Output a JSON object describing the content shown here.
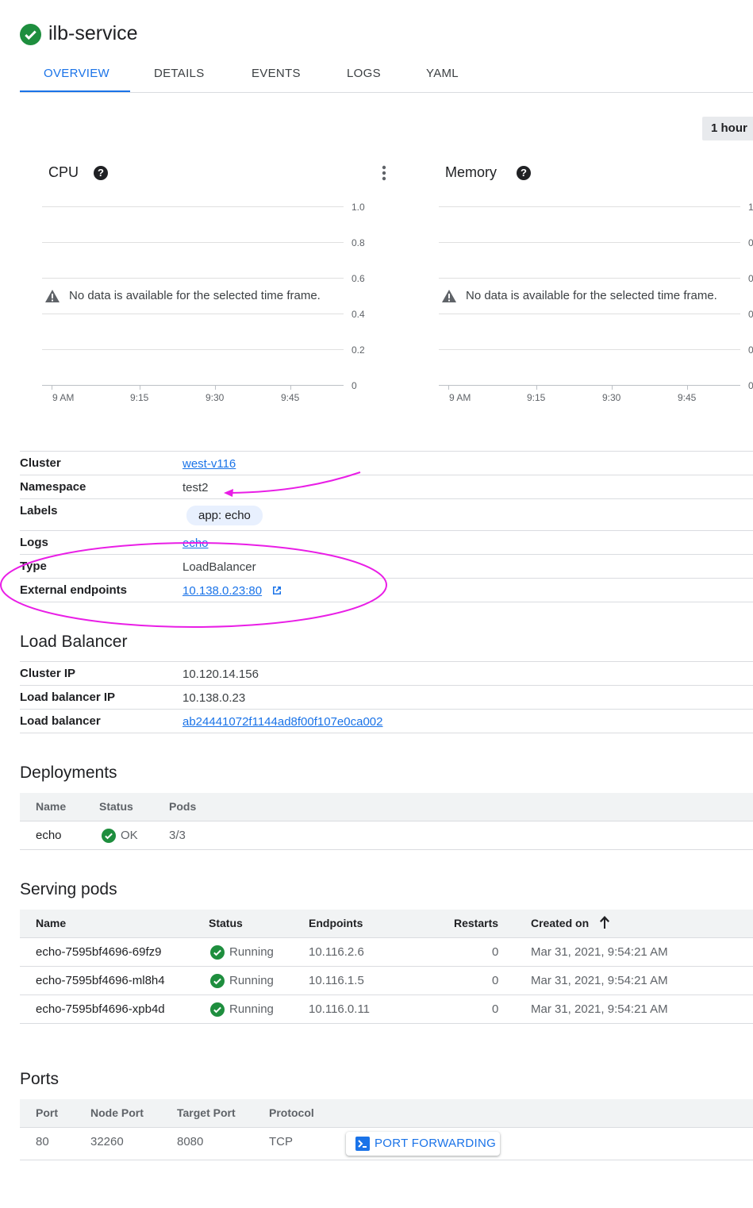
{
  "header": {
    "title": "ilb-service",
    "status_icon": "check-circle-icon",
    "status_color": "#1e8e3e"
  },
  "tabs": [
    {
      "label": "OVERVIEW",
      "active": true
    },
    {
      "label": "DETAILS"
    },
    {
      "label": "EVENTS"
    },
    {
      "label": "LOGS"
    },
    {
      "label": "YAML"
    }
  ],
  "time_range": "1 hour",
  "charts": {
    "cpu": {
      "title": "CPU",
      "no_data": "No data is available for the selected time frame.",
      "y_ticks": [
        "1.0",
        "0.8",
        "0.6",
        "0.4",
        "0.2",
        "0"
      ],
      "x_ticks": [
        "9 AM",
        "9:15",
        "9:30",
        "9:45"
      ]
    },
    "memory": {
      "title": "Memory",
      "no_data": "No data is available for the selected time frame.",
      "y_ticks": [
        "1",
        "0",
        "0",
        "0",
        "0",
        "0"
      ],
      "x_ticks": [
        "9 AM",
        "9:15",
        "9:30",
        "9:45"
      ]
    }
  },
  "properties": {
    "cluster": {
      "label": "Cluster",
      "value": "west-v116"
    },
    "namespace": {
      "label": "Namespace",
      "value": "test2"
    },
    "labels": {
      "label": "Labels",
      "value": "app: echo"
    },
    "logs": {
      "label": "Logs",
      "value": "echo"
    },
    "type": {
      "label": "Type",
      "value": "LoadBalancer"
    },
    "external": {
      "label": "External endpoints",
      "value": "10.138.0.23:80"
    }
  },
  "load_balancer": {
    "title": "Load Balancer",
    "cluster_ip": {
      "label": "Cluster IP",
      "value": "10.120.14.156"
    },
    "lb_ip": {
      "label": "Load balancer IP",
      "value": "10.138.0.23"
    },
    "lb": {
      "label": "Load balancer",
      "value": "ab24441072f1144ad8f00f107e0ca002"
    }
  },
  "deployments": {
    "title": "Deployments",
    "headers": [
      "Name",
      "Status",
      "Pods"
    ],
    "rows": [
      {
        "name": "echo",
        "status": "OK",
        "pods": "3/3"
      }
    ]
  },
  "serving_pods": {
    "title": "Serving pods",
    "headers": [
      "Name",
      "Status",
      "Endpoints",
      "Restarts",
      "Created on"
    ],
    "rows": [
      {
        "name": "echo-7595bf4696-69fz9",
        "status": "Running",
        "endpoint": "10.116.2.6",
        "restarts": "0",
        "created": "Mar 31, 2021, 9:54:21 AM"
      },
      {
        "name": "echo-7595bf4696-ml8h4",
        "status": "Running",
        "endpoint": "10.116.1.5",
        "restarts": "0",
        "created": "Mar 31, 2021, 9:54:21 AM"
      },
      {
        "name": "echo-7595bf4696-xpb4d",
        "status": "Running",
        "endpoint": "10.116.0.11",
        "restarts": "0",
        "created": "Mar 31, 2021, 9:54:21 AM"
      }
    ]
  },
  "ports": {
    "title": "Ports",
    "headers": [
      "Port",
      "Node Port",
      "Target Port",
      "Protocol"
    ],
    "rows": [
      {
        "port": "80",
        "node_port": "32260",
        "target_port": "8080",
        "protocol": "TCP"
      }
    ],
    "action": "PORT FORWARDING"
  },
  "annotation_color": "#e91ee6"
}
